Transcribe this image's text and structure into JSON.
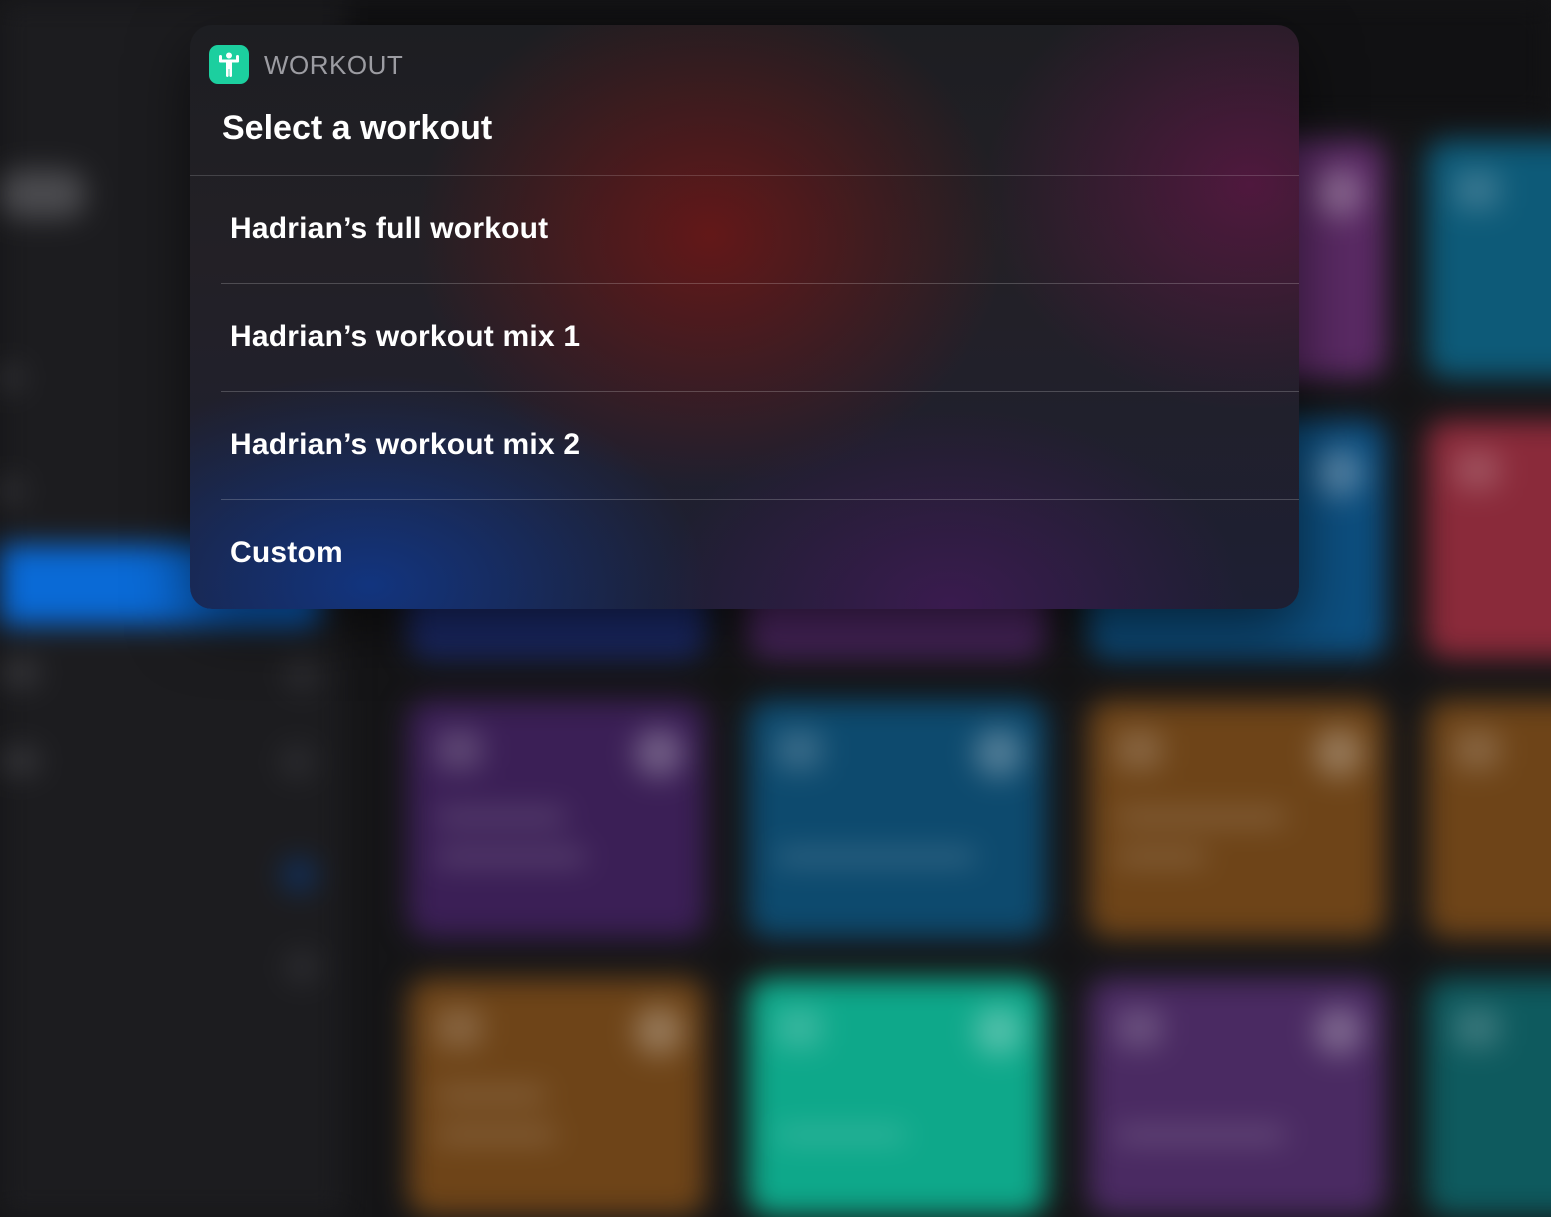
{
  "sheet": {
    "app_icon": "workout-figure-icon",
    "app_name": "WORKOUT",
    "prompt": "Select a workout",
    "options": [
      {
        "label": "Hadrian’s full workout"
      },
      {
        "label": "Hadrian’s workout mix 1"
      },
      {
        "label": "Hadrian’s workout mix 2"
      },
      {
        "label": "Custom"
      }
    ]
  },
  "colors": {
    "app_icon_bg": "#1ccf9f",
    "sidebar_selection": "#0a6ad6",
    "tiles": [
      "#3b1f56",
      "#0d4a6e",
      "#6e4418",
      "#6e4418",
      "#0ea88a",
      "#4a2a62",
      "#5a2a64",
      "#0d5a78",
      "#8a2a3a",
      "#0e5a5e"
    ]
  }
}
